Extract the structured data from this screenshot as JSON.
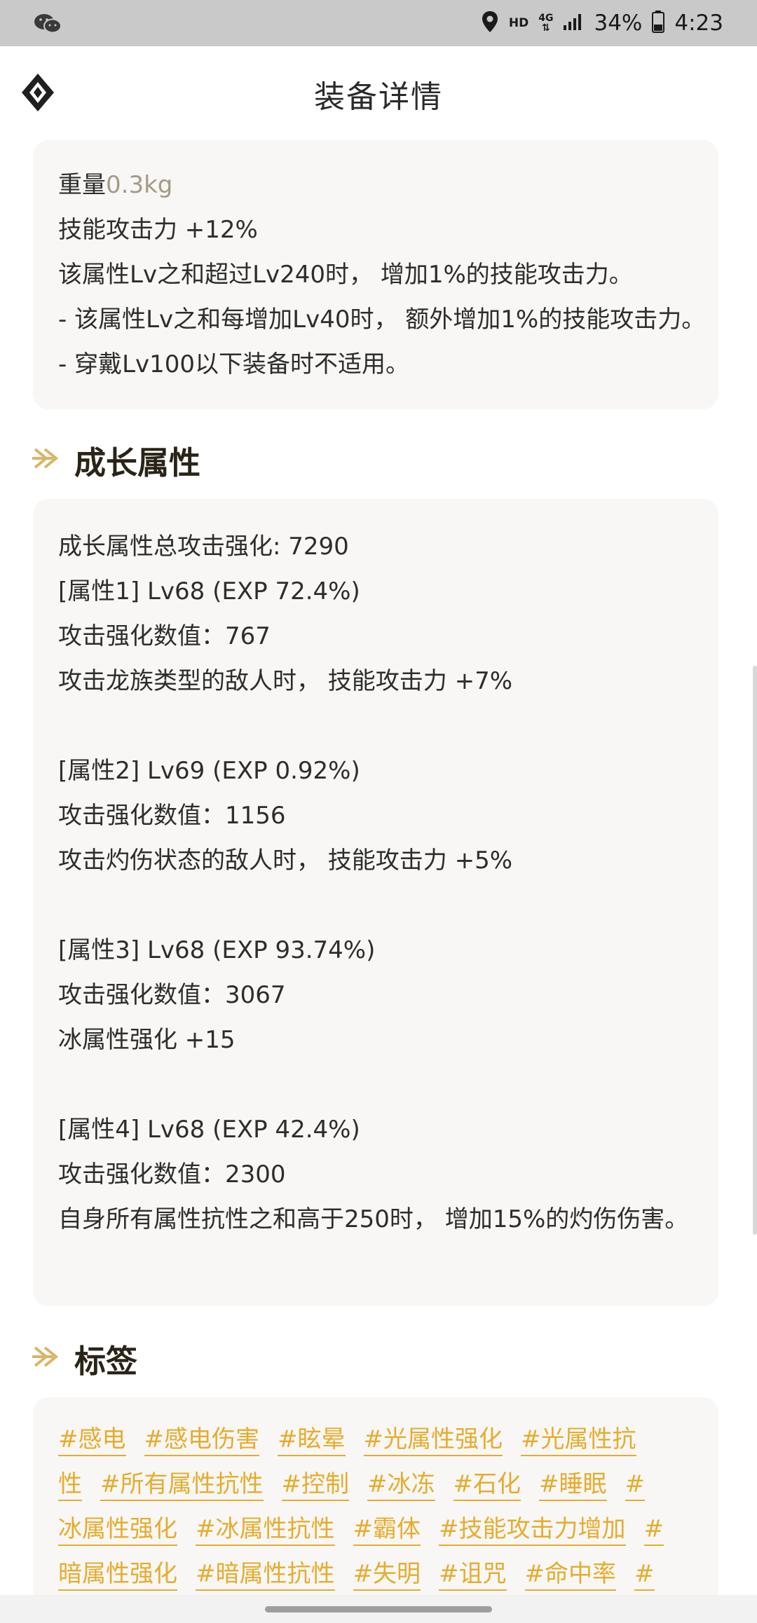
{
  "status_bar": {
    "network_hd": "HD",
    "network_4g": "4G",
    "battery": "34%",
    "time": "4:23"
  },
  "header": {
    "title": "装备详情"
  },
  "attributes": {
    "weight_label": "重量",
    "weight_value": "0.3kg",
    "lines": [
      "技能攻击力 +12%",
      "该属性Lv之和超过Lv240时， 增加1%的技能攻击力。",
      "- 该属性Lv之和每增加Lv40时， 额外增加1%的技能攻击力。",
      "- 穿戴Lv100以下装备时不适用。"
    ]
  },
  "growth": {
    "title": "成长属性",
    "total": "成长属性总攻击强化: 7290",
    "groups": [
      {
        "header": "[属性1] Lv68 (EXP 72.4%)",
        "value": "攻击强化数值：767",
        "effect": "攻击龙族类型的敌人时， 技能攻击力 +7%"
      },
      {
        "header": "[属性2] Lv69 (EXP 0.92%)",
        "value": "攻击强化数值：1156",
        "effect": "攻击灼伤状态的敌人时， 技能攻击力 +5%"
      },
      {
        "header": "[属性3] Lv68 (EXP 93.74%)",
        "value": "攻击强化数值：3067",
        "effect": "冰属性强化 +15"
      },
      {
        "header": "[属性4] Lv68 (EXP 42.4%)",
        "value": "攻击强化数值：2300",
        "effect": "自身所有属性抗性之和高于250时， 增加15%的灼伤伤害。"
      }
    ]
  },
  "tags": {
    "title": "标签",
    "rows": [
      [
        "#感电",
        "#感电伤害",
        "#眩晕",
        "#光属性强化",
        "#光属性抗"
      ],
      [
        "性",
        "#所有属性抗性",
        "#控制",
        "#冰冻",
        "#石化",
        "#睡眠",
        "#"
      ],
      [
        "冰属性强化",
        "#冰属性抗性",
        "#霸体",
        "#技能攻击力增加",
        "#"
      ],
      [
        "暗属性强化",
        "#暗属性抗性",
        "#失明",
        "#诅咒",
        "#命中率",
        "#"
      ]
    ]
  },
  "colors": {
    "accent": "#e6ac2e",
    "card_bg": "#f8f7f5",
    "status_bar": "#c9c9c9"
  }
}
